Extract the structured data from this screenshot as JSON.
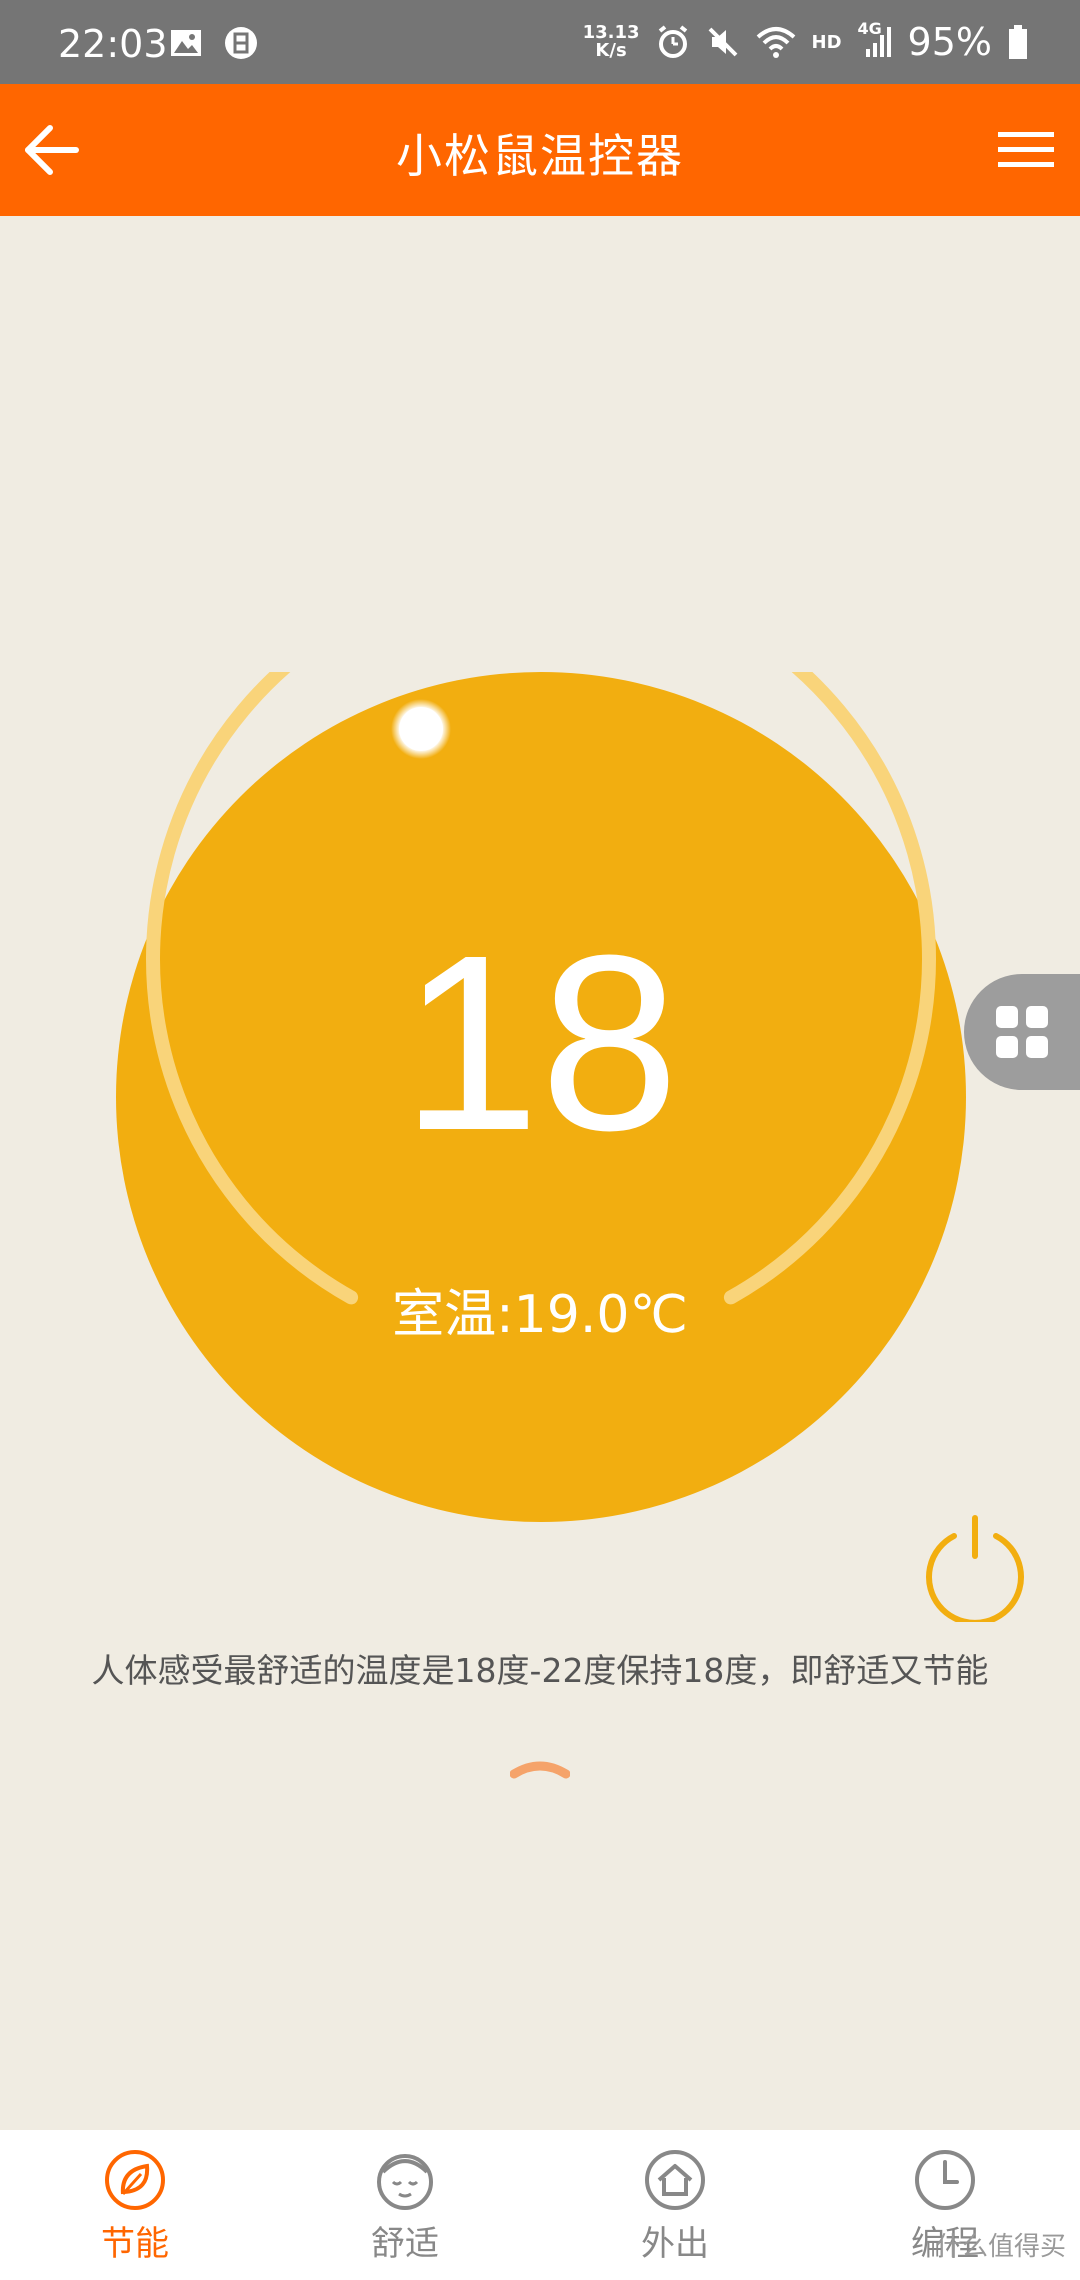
{
  "status": {
    "time": "22:03",
    "net_speed_top": "13.13",
    "net_speed_bottom": "K/s",
    "hd": "HD",
    "network": "4G",
    "battery": "95%"
  },
  "app_bar": {
    "title": "小松鼠温控器"
  },
  "thermostat": {
    "set_temp": "18",
    "room_temp_label": "室温:19.0℃",
    "tip": "人体感受最舒适的温度是18度-22度保持18度，即舒适又节能"
  },
  "nav": [
    {
      "label": "节能",
      "icon": "leaf-icon",
      "active": true
    },
    {
      "label": "舒适",
      "icon": "sleep-face-icon",
      "active": false
    },
    {
      "label": "外出",
      "icon": "house-icon",
      "active": false
    },
    {
      "label": "编程",
      "icon": "clock-icon",
      "active": false
    }
  ],
  "watermark": "什么值得买",
  "colors": {
    "accent": "#ff6600",
    "dial": "#f2ae10",
    "background": "#f0ece2"
  }
}
